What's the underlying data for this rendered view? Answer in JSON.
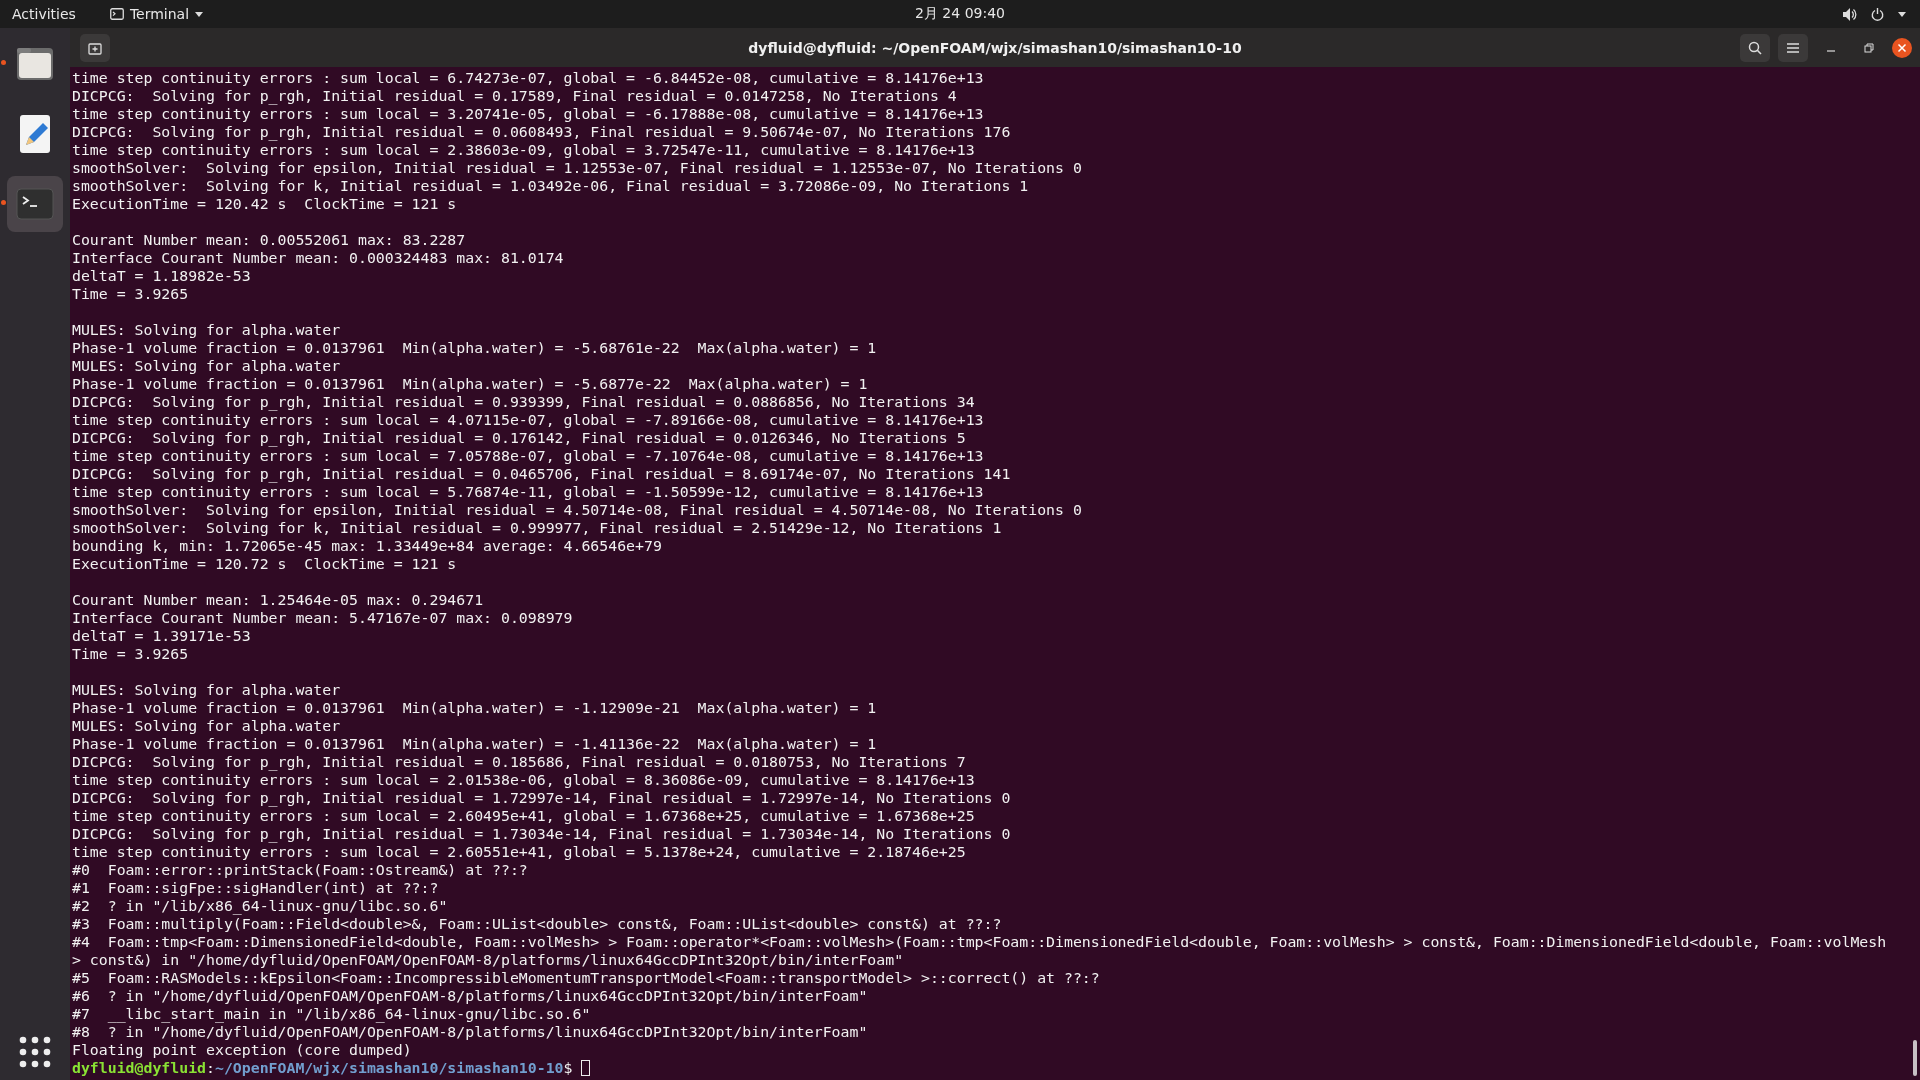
{
  "top_bar": {
    "activities": "Activities",
    "app_menu": "Terminal",
    "clock": "2月 24 09:40"
  },
  "dock": {
    "apps": [
      {
        "kind": "files",
        "running": true,
        "selected": false
      },
      {
        "kind": "editor",
        "running": false,
        "selected": false
      },
      {
        "kind": "terminal",
        "running": true,
        "selected": true
      }
    ]
  },
  "window": {
    "title": "dyfluid@dyfluid: ~/OpenFOAM/wjx/simashan10/simashan10-10"
  },
  "terminal": {
    "lines": [
      {
        "kind": "output",
        "text": "time step continuity errors : sum local = 6.74273e-07, global = -6.84452e-08, cumulative = 8.14176e+13"
      },
      {
        "kind": "output",
        "text": "DICPCG:  Solving for p_rgh, Initial residual = 0.17589, Final residual = 0.0147258, No Iterations 4"
      },
      {
        "kind": "output",
        "text": "time step continuity errors : sum local = 3.20741e-05, global = -6.17888e-08, cumulative = 8.14176e+13"
      },
      {
        "kind": "output",
        "text": "DICPCG:  Solving for p_rgh, Initial residual = 0.0608493, Final residual = 9.50674e-07, No Iterations 176"
      },
      {
        "kind": "output",
        "text": "time step continuity errors : sum local = 2.38603e-09, global = 3.72547e-11, cumulative = 8.14176e+13"
      },
      {
        "kind": "output",
        "text": "smoothSolver:  Solving for epsilon, Initial residual = 1.12553e-07, Final residual = 1.12553e-07, No Iterations 0"
      },
      {
        "kind": "output",
        "text": "smoothSolver:  Solving for k, Initial residual = 1.03492e-06, Final residual = 3.72086e-09, No Iterations 1"
      },
      {
        "kind": "output",
        "text": "ExecutionTime = 120.42 s  ClockTime = 121 s"
      },
      {
        "kind": "blank"
      },
      {
        "kind": "output",
        "text": "Courant Number mean: 0.00552061 max: 83.2287"
      },
      {
        "kind": "output",
        "text": "Interface Courant Number mean: 0.000324483 max: 81.0174"
      },
      {
        "kind": "output",
        "text": "deltaT = 1.18982e-53"
      },
      {
        "kind": "output",
        "text": "Time = 3.9265"
      },
      {
        "kind": "blank"
      },
      {
        "kind": "output",
        "text": "MULES: Solving for alpha.water"
      },
      {
        "kind": "output",
        "text": "Phase-1 volume fraction = 0.0137961  Min(alpha.water) = -5.68761e-22  Max(alpha.water) = 1"
      },
      {
        "kind": "output",
        "text": "MULES: Solving for alpha.water"
      },
      {
        "kind": "output",
        "text": "Phase-1 volume fraction = 0.0137961  Min(alpha.water) = -5.6877e-22  Max(alpha.water) = 1"
      },
      {
        "kind": "output",
        "text": "DICPCG:  Solving for p_rgh, Initial residual = 0.939399, Final residual = 0.0886856, No Iterations 34"
      },
      {
        "kind": "output",
        "text": "time step continuity errors : sum local = 4.07115e-07, global = -7.89166e-08, cumulative = 8.14176e+13"
      },
      {
        "kind": "output",
        "text": "DICPCG:  Solving for p_rgh, Initial residual = 0.176142, Final residual = 0.0126346, No Iterations 5"
      },
      {
        "kind": "output",
        "text": "time step continuity errors : sum local = 7.05788e-07, global = -7.10764e-08, cumulative = 8.14176e+13"
      },
      {
        "kind": "output",
        "text": "DICPCG:  Solving for p_rgh, Initial residual = 0.0465706, Final residual = 8.69174e-07, No Iterations 141"
      },
      {
        "kind": "output",
        "text": "time step continuity errors : sum local = 5.76874e-11, global = -1.50599e-12, cumulative = 8.14176e+13"
      },
      {
        "kind": "output",
        "text": "smoothSolver:  Solving for epsilon, Initial residual = 4.50714e-08, Final residual = 4.50714e-08, No Iterations 0"
      },
      {
        "kind": "output",
        "text": "smoothSolver:  Solving for k, Initial residual = 0.999977, Final residual = 2.51429e-12, No Iterations 1"
      },
      {
        "kind": "output",
        "text": "bounding k, min: 1.72065e-45 max: 1.33449e+84 average: 4.66546e+79"
      },
      {
        "kind": "output",
        "text": "ExecutionTime = 120.72 s  ClockTime = 121 s"
      },
      {
        "kind": "blank"
      },
      {
        "kind": "output",
        "text": "Courant Number mean: 1.25464e-05 max: 0.294671"
      },
      {
        "kind": "output",
        "text": "Interface Courant Number mean: 5.47167e-07 max: 0.098979"
      },
      {
        "kind": "output",
        "text": "deltaT = 1.39171e-53"
      },
      {
        "kind": "output",
        "text": "Time = 3.9265"
      },
      {
        "kind": "blank"
      },
      {
        "kind": "output",
        "text": "MULES: Solving for alpha.water"
      },
      {
        "kind": "output",
        "text": "Phase-1 volume fraction = 0.0137961  Min(alpha.water) = -1.12909e-21  Max(alpha.water) = 1"
      },
      {
        "kind": "output",
        "text": "MULES: Solving for alpha.water"
      },
      {
        "kind": "output",
        "text": "Phase-1 volume fraction = 0.0137961  Min(alpha.water) = -1.41136e-22  Max(alpha.water) = 1"
      },
      {
        "kind": "output",
        "text": "DICPCG:  Solving for p_rgh, Initial residual = 0.185686, Final residual = 0.0180753, No Iterations 7"
      },
      {
        "kind": "output",
        "text": "time step continuity errors : sum local = 2.01538e-06, global = 8.36086e-09, cumulative = 8.14176e+13"
      },
      {
        "kind": "output",
        "text": "DICPCG:  Solving for p_rgh, Initial residual = 1.72997e-14, Final residual = 1.72997e-14, No Iterations 0"
      },
      {
        "kind": "output",
        "text": "time step continuity errors : sum local = 2.60495e+41, global = 1.67368e+25, cumulative = 1.67368e+25"
      },
      {
        "kind": "output",
        "text": "DICPCG:  Solving for p_rgh, Initial residual = 1.73034e-14, Final residual = 1.73034e-14, No Iterations 0"
      },
      {
        "kind": "output",
        "text": "time step continuity errors : sum local = 2.60551e+41, global = 5.1378e+24, cumulative = 2.18746e+25"
      },
      {
        "kind": "output",
        "text": "#0  Foam::error::printStack(Foam::Ostream&) at ??:?"
      },
      {
        "kind": "output",
        "text": "#1  Foam::sigFpe::sigHandler(int) at ??:?"
      },
      {
        "kind": "output",
        "text": "#2  ? in \"/lib/x86_64-linux-gnu/libc.so.6\""
      },
      {
        "kind": "output",
        "text": "#3  Foam::multiply(Foam::Field<double>&, Foam::UList<double> const&, Foam::UList<double> const&) at ??:?"
      },
      {
        "kind": "output",
        "text": "#4  Foam::tmp<Foam::DimensionedField<double, Foam::volMesh> > Foam::operator*<Foam::volMesh>(Foam::tmp<Foam::DimensionedField<double, Foam::volMesh> > const&, Foam::DimensionedField<double, Foam::volMesh"
      },
      {
        "kind": "output",
        "text": "> const&) in \"/home/dyfluid/OpenFOAM/OpenFOAM-8/platforms/linux64GccDPInt32Opt/bin/interFoam\""
      },
      {
        "kind": "output",
        "text": "#5  Foam::RASModels::kEpsilon<Foam::IncompressibleMomentumTransportModel<Foam::transportModel> >::correct() at ??:?"
      },
      {
        "kind": "output",
        "text": "#6  ? in \"/home/dyfluid/OpenFOAM/OpenFOAM-8/platforms/linux64GccDPInt32Opt/bin/interFoam\""
      },
      {
        "kind": "output",
        "text": "#7  __libc_start_main in \"/lib/x86_64-linux-gnu/libc.so.6\""
      },
      {
        "kind": "output",
        "text": "#8  ? in \"/home/dyfluid/OpenFOAM/OpenFOAM-8/platforms/linux64GccDPInt32Opt/bin/interFoam\""
      },
      {
        "kind": "output",
        "text": "Floating point exception (core dumped)"
      }
    ],
    "prompt": {
      "user": "dyfluid@dyfluid",
      "separator": ":",
      "path": "~/OpenFOAM/wjx/simashan10/simashan10-10",
      "symbol": "$"
    }
  }
}
